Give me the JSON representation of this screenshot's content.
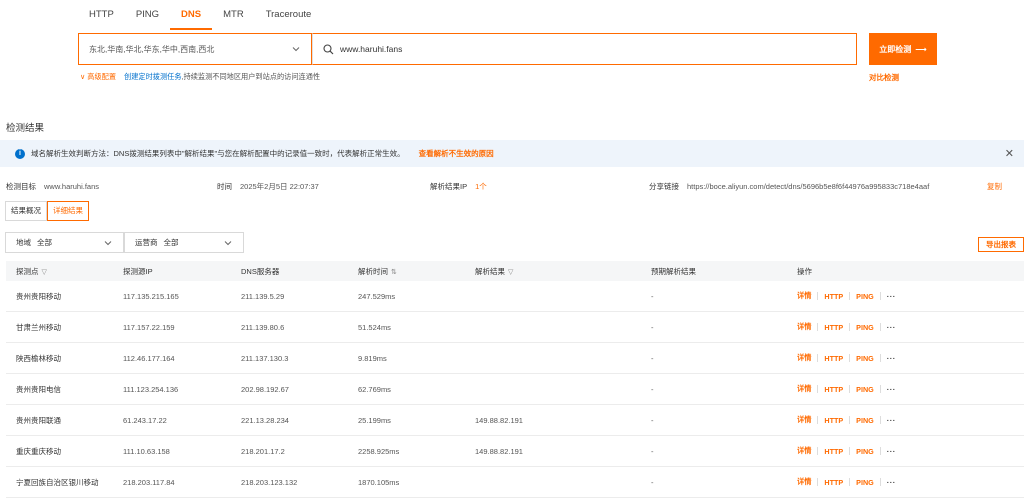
{
  "tabs": [
    "HTTP",
    "PING",
    "DNS",
    "MTR",
    "Traceroute"
  ],
  "active_tab": "DNS",
  "search": {
    "regions_value": "东北,华南,华北,华东,华中,西南,西北",
    "domain_value": "www.haruhi.fans",
    "detect_label": "立即检测",
    "detect_arrow": "⟶",
    "compare_label": "对比检测"
  },
  "advanced": {
    "adv_label": "高级配置",
    "sched_label": "创建定时拨测任务",
    "sched_text": ",持续监测不同地区用户到站点的访问连通性"
  },
  "section_title": "检测结果",
  "notice": {
    "text": "域名解析生效判断方法：DNS拨测结果列表中\"解析结果\"与您在解析配置中的记录值一致时，代表解析正常生效。",
    "link": "查看解析不生效的原因",
    "close": "✕"
  },
  "meta": {
    "target_label": "检测目标",
    "target_value": "www.haruhi.fans",
    "time_label": "时间",
    "time_value": "2025年2月5日 22:07:37",
    "ip_label": "解析结果IP",
    "ip_value": "1个",
    "share_label": "分享链接",
    "share_value": "https://boce.aliyun.com/detect/dns/5696b5e8f6f44976a995833c718e4aaf",
    "copy_label": "复制"
  },
  "result_tabs": [
    "结果概况",
    "详细结果"
  ],
  "active_result_tab": "详细结果",
  "filters": {
    "region_label": "地域",
    "region_value": "全部",
    "isp_label": "运营商",
    "isp_value": "全部"
  },
  "export_label": "导出报表",
  "table": {
    "headers": [
      "探测点",
      "探测源IP",
      "DNS服务器",
      "解析时间",
      "解析结果",
      "预期解析结果",
      "操作"
    ],
    "ops": [
      "详情",
      "HTTP",
      "PING",
      "···"
    ],
    "rows": [
      {
        "point": "贵州贵阳移动",
        "src_ip": "117.135.215.165",
        "dns": "211.139.5.29",
        "time": "247.529ms",
        "result": "",
        "expected": "-"
      },
      {
        "point": "甘肃兰州移动",
        "src_ip": "117.157.22.159",
        "dns": "211.139.80.6",
        "time": "51.524ms",
        "result": "",
        "expected": "-"
      },
      {
        "point": "陕西榆林移动",
        "src_ip": "112.46.177.164",
        "dns": "211.137.130.3",
        "time": "9.819ms",
        "result": "",
        "expected": "-"
      },
      {
        "point": "贵州贵阳电信",
        "src_ip": "111.123.254.136",
        "dns": "202.98.192.67",
        "time": "62.769ms",
        "result": "",
        "expected": "-"
      },
      {
        "point": "贵州贵阳联通",
        "src_ip": "61.243.17.22",
        "dns": "221.13.28.234",
        "time": "25.199ms",
        "result": "149.88.82.191",
        "expected": "-"
      },
      {
        "point": "重庆重庆移动",
        "src_ip": "111.10.63.158",
        "dns": "218.201.17.2",
        "time": "2258.925ms",
        "result": "149.88.82.191",
        "expected": "-"
      },
      {
        "point": "宁夏回族自治区银川移动",
        "src_ip": "218.203.117.84",
        "dns": "218.203.123.132",
        "time": "1870.105ms",
        "result": "",
        "expected": "-"
      }
    ]
  },
  "colors": {
    "accent": "#ff6a00",
    "link": "#0070cc",
    "notice_bg": "#eef4fb"
  }
}
